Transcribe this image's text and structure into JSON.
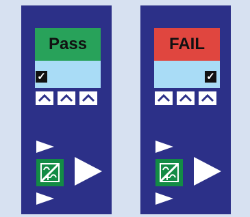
{
  "panels": {
    "left": {
      "status_text": "Pass",
      "status_color": "#28a25a",
      "checkbox": "✓"
    },
    "right": {
      "status_text": "FAIL",
      "status_color": "#e0463f",
      "checkbox": "✓"
    }
  },
  "icons": {
    "arrow_up": "chevron-up-icon",
    "left_triangle": "play-left-icon",
    "large_triangle": "play-right-icon",
    "green_icon": "measurement-icon"
  },
  "colors": {
    "background": "#d7e1f1",
    "panel": "#2c3088",
    "light_band": "#a9dcf6",
    "white": "#ffffff"
  }
}
